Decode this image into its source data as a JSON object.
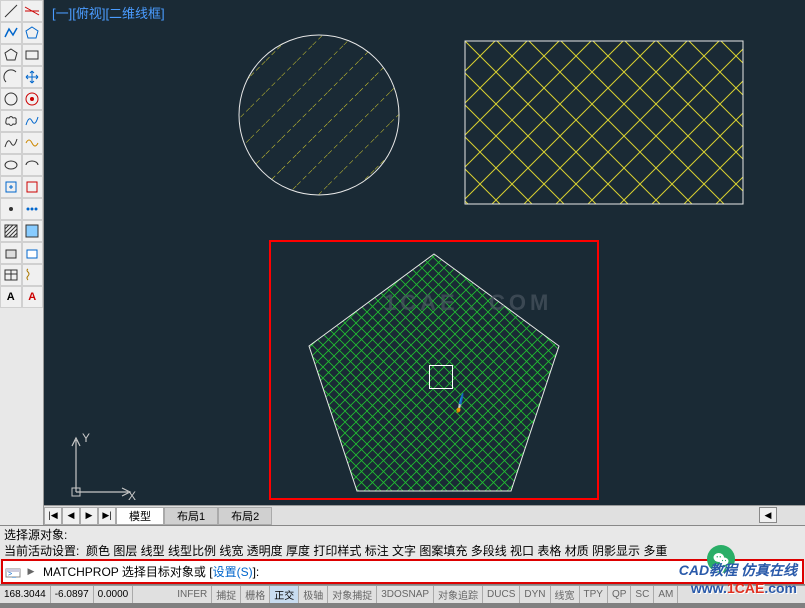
{
  "viewport": {
    "label": "[一][俯视][二维线框]"
  },
  "ucs": {
    "y_label": "Y",
    "x_label": "X"
  },
  "watermark": "1CAE . COM",
  "tabs": {
    "nav": [
      "|◀",
      "◀",
      "▶",
      "▶|"
    ],
    "items": [
      {
        "label": "模型",
        "active": true
      },
      {
        "label": "布局1",
        "active": false
      },
      {
        "label": "布局2",
        "active": false
      }
    ],
    "scroll_right": "◀"
  },
  "command": {
    "line1": "选择源对象:",
    "line2_prefix": "当前活动设置:",
    "line2_settings": "颜色 图层 线型 线型比例 线宽 透明度 厚度 打印样式 标注 文字 图案填充 多段线 视口 表格 材质 阴影显示 多重",
    "prompt_cmd": "MATCHPROP",
    "prompt_text": " 选择目标对象或 [",
    "prompt_setting": "设置(S)",
    "prompt_end": "]:"
  },
  "status": {
    "coords": [
      "168.3044",
      "-6.0897",
      "0.0000"
    ],
    "toggles": [
      "INFER",
      "捕捉",
      "栅格",
      "正交",
      "极轴",
      "对象捕捉",
      "3DOSNAP",
      "对象追踪",
      "DUCS",
      "DYN",
      "线宽",
      "TPY",
      "QP",
      "SC",
      "AM"
    ]
  },
  "overlay": {
    "wechat_icon": "●",
    "badge_text": "CAD教程 仿真在线",
    "url_pre": "www.",
    "url_main": "1CAE",
    "url_suf": ".com"
  },
  "tool_icons": [
    "line",
    "xline",
    "pline",
    "polygon",
    "rect",
    "arc",
    "circle",
    "revcloud",
    "spline",
    "ellipse",
    "earc",
    "insert",
    "block",
    "hatch",
    "grad",
    "region",
    "table",
    "point",
    "mtext",
    "helix",
    "donut",
    "wipeout",
    "text-a",
    "axis"
  ]
}
